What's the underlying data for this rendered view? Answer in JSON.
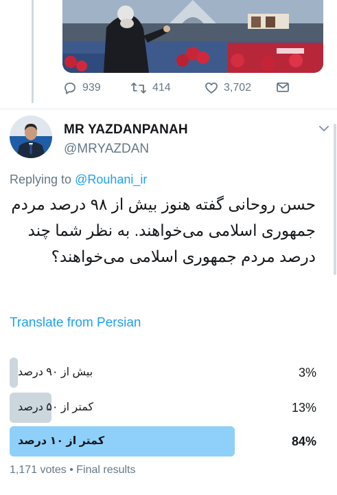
{
  "previous_tweet": {
    "media_icon": "photo-rally-podium",
    "reply_count": "939",
    "retweet_count": "414",
    "like_count": "3,702",
    "icons": [
      "reply-icon",
      "retweet-icon",
      "like-icon",
      "message-icon"
    ]
  },
  "tweet": {
    "display_name": "MR YAZDANPANAH",
    "handle": "@MRYAZDAN",
    "replying_prefix": "Replying to",
    "replying_to": "@Rouhani_ir",
    "text": "حسن روحانی گفته هنوز بیش از ۹۸ درصد مردم جمهوری اسلامی می‌خواهند. به نظر شما چند درصد مردم جمهوری اسلامی می‌خواهند؟",
    "translate_label": "Translate from Persian"
  },
  "poll": {
    "options": [
      {
        "label": "بیش از ۹۰ درصد",
        "percent_label": "3%",
        "fraction": 0.03
      },
      {
        "label": "کمتر از ۵۰ درصد",
        "percent_label": "13%",
        "fraction": 0.13
      },
      {
        "label": "کمتر از ۱۰ درصد",
        "percent_label": "84%",
        "fraction": 0.84
      }
    ],
    "votes_label": "1,171 votes",
    "separator": "•",
    "status_label": "Final results"
  },
  "colors": {
    "accent": "#1da1f2",
    "secondary_text": "#657786",
    "poll_bar": "#ccd6dd",
    "poll_bar_winner": "#8ed0f9"
  }
}
